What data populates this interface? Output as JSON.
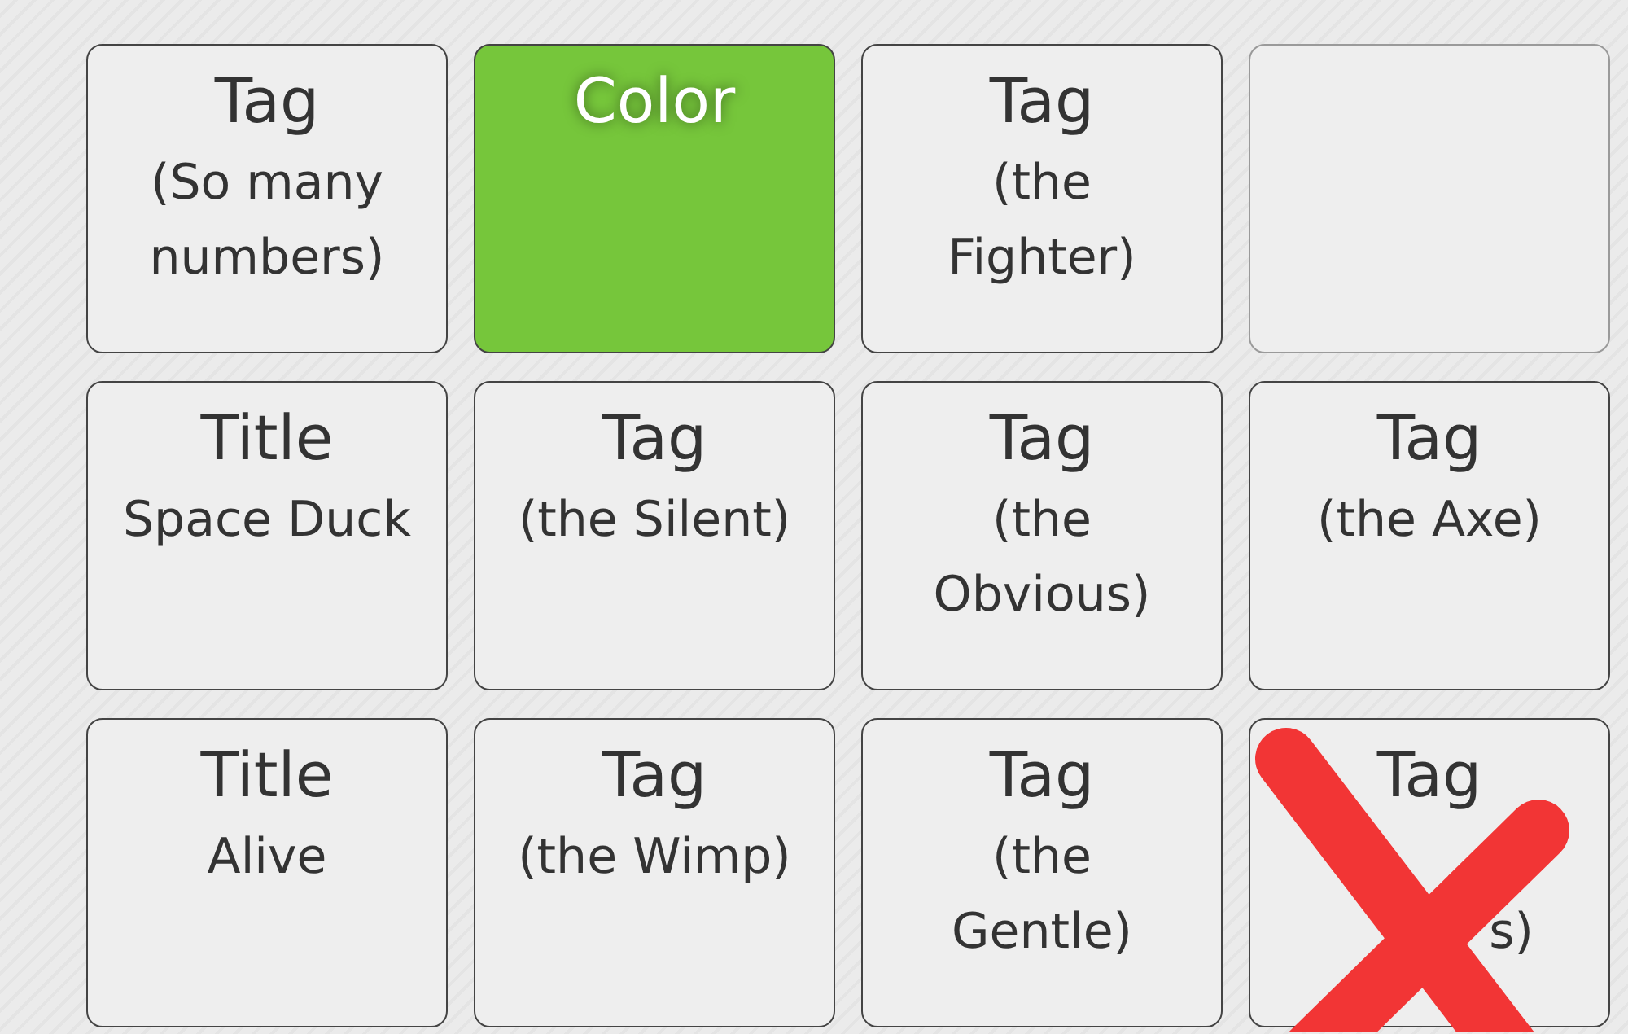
{
  "tiles": [
    {
      "kind": "tag",
      "title": "Tag",
      "subtitle": "(So many\nnumbers)"
    },
    {
      "kind": "color",
      "title": "Color",
      "color": "#76c63b"
    },
    {
      "kind": "tag",
      "title": "Tag",
      "subtitle": "(the\nFighter)"
    },
    {
      "kind": "empty"
    },
    {
      "kind": "title",
      "title": "Title",
      "subtitle": "Space Duck"
    },
    {
      "kind": "tag",
      "title": "Tag",
      "subtitle": "(the Silent)"
    },
    {
      "kind": "tag",
      "title": "Tag",
      "subtitle": "(the\nObvious)"
    },
    {
      "kind": "tag",
      "title": "Tag",
      "subtitle": "(the Axe)"
    },
    {
      "kind": "title",
      "title": "Title",
      "subtitle": "Alive"
    },
    {
      "kind": "tag",
      "title": "Tag",
      "subtitle": "(the Wimp)"
    },
    {
      "kind": "tag",
      "title": "Tag",
      "subtitle": "(the\nGentle)"
    },
    {
      "kind": "tag",
      "title": "Tag",
      "subtitle": "s)",
      "crossed": true
    }
  ]
}
